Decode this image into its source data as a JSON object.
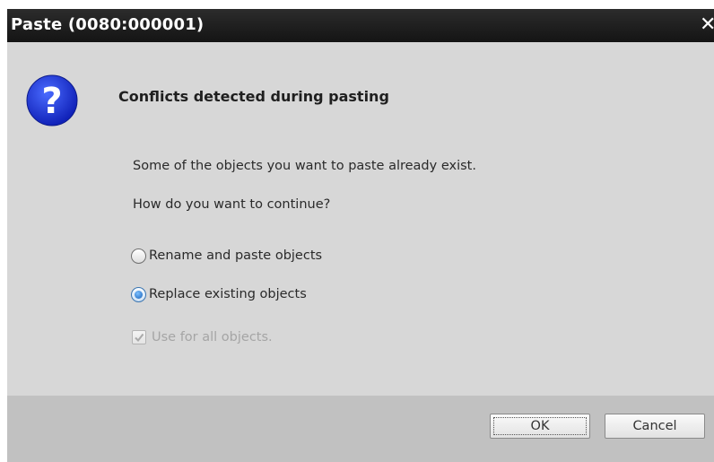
{
  "window": {
    "title": "Paste (0080:000001)",
    "close_glyph": "✕"
  },
  "dialog": {
    "icon": "question-icon",
    "icon_color": "#1e2fd6",
    "heading": "Conflicts detected during pasting",
    "message1": "Some of the objects you want to paste already exist.",
    "message2": "How do you want to continue?",
    "options": [
      {
        "label": "Rename and paste objects",
        "selected": false
      },
      {
        "label": "Replace existing objects",
        "selected": true
      }
    ],
    "checkbox": {
      "label": "Use for all objects.",
      "checked": true,
      "enabled": false
    }
  },
  "buttons": {
    "ok": "OK",
    "cancel": "Cancel"
  }
}
